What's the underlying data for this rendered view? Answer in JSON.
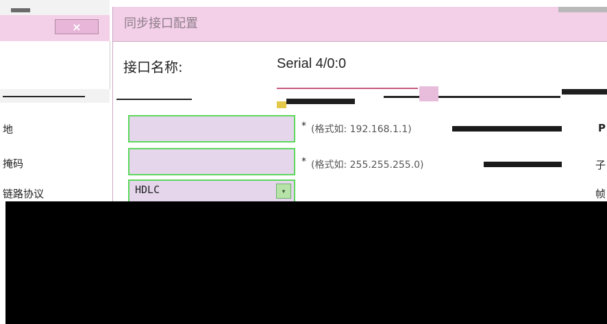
{
  "dialog": {
    "title": "同步接口配置",
    "close_label": "×"
  },
  "form": {
    "interface_name_label": "接口名称:",
    "interface_name_value": "Serial 4/0:0",
    "ip_label": "地",
    "ip_hint": "(格式如: 192.168.1.1)",
    "mask_label": "掩码",
    "mask_hint": "(格式如: 255.255.255.0)",
    "protocol_label": "链路协议",
    "protocol_value": "HDLC",
    "required_mark": "*",
    "right_label_1": "P",
    "right_label_2": "子",
    "right_label_3": "帧"
  },
  "icons": {
    "close": "close-icon",
    "dropdown": "chevron-down-icon"
  },
  "colors": {
    "title_bar": "#f3cfe8",
    "input_fill": "#e5d6ec",
    "input_border": "#5bd85b"
  }
}
